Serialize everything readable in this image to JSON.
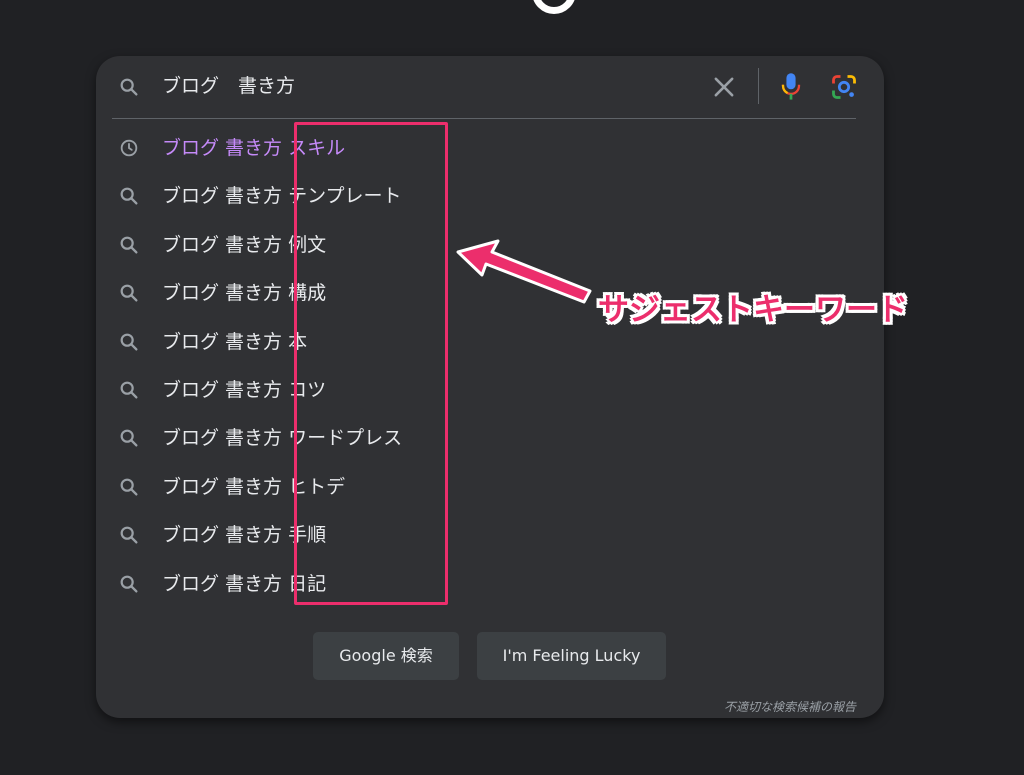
{
  "search": {
    "query": "ブログ　書き方"
  },
  "suggestions": [
    {
      "prefix": "ブログ 書き方",
      "suffix": "スキル",
      "type": "history",
      "icon": "history-icon"
    },
    {
      "prefix": "ブログ 書き方",
      "suffix": "テンプレート",
      "type": "search",
      "icon": "search-icon"
    },
    {
      "prefix": "ブログ 書き方",
      "suffix": "例文",
      "type": "search",
      "icon": "search-icon"
    },
    {
      "prefix": "ブログ 書き方",
      "suffix": "構成",
      "type": "search",
      "icon": "search-icon"
    },
    {
      "prefix": "ブログ 書き方",
      "suffix": "本",
      "type": "search",
      "icon": "search-icon"
    },
    {
      "prefix": "ブログ 書き方",
      "suffix": "コツ",
      "type": "search",
      "icon": "search-icon"
    },
    {
      "prefix": "ブログ 書き方",
      "suffix": "ワードプレス",
      "type": "search",
      "icon": "search-icon"
    },
    {
      "prefix": "ブログ 書き方",
      "suffix": "ヒトデ",
      "type": "search",
      "icon": "search-icon"
    },
    {
      "prefix": "ブログ 書き方",
      "suffix": "手順",
      "type": "search",
      "icon": "search-icon"
    },
    {
      "prefix": "ブログ 書き方",
      "suffix": "日記",
      "type": "search",
      "icon": "search-icon"
    }
  ],
  "buttons": {
    "search_label": "Google 検索",
    "lucky_label": "I'm Feeling Lucky"
  },
  "footer": {
    "report_link": "不適切な検索候補の報告"
  },
  "annotation": {
    "label": "サジェストキーワード"
  },
  "colors": {
    "background": "#202124",
    "panel": "#303134",
    "text": "#e8eaed",
    "history_text": "#c58af9",
    "annotation_accent": "#ec2e6c",
    "button_bg": "#3c4043"
  }
}
